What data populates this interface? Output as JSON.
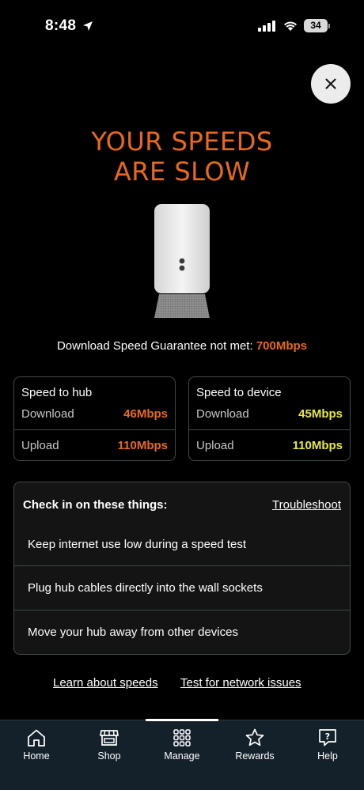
{
  "status_bar": {
    "time": "8:48",
    "battery": "34"
  },
  "headline": {
    "line1": "YOUR SPEEDS",
    "line2": "ARE SLOW"
  },
  "guarantee": {
    "text": "Download Speed Guarantee not met:",
    "value": "700Mbps"
  },
  "speed_cards": {
    "hub": {
      "title": "Speed to hub",
      "download_label": "Download",
      "download_value": "46Mbps",
      "upload_label": "Upload",
      "upload_value": "110Mbps"
    },
    "device": {
      "title": "Speed to device",
      "download_label": "Download",
      "download_value": "45Mbps",
      "upload_label": "Upload",
      "upload_value": "110Mbps"
    }
  },
  "check_panel": {
    "title": "Check in on these things:",
    "troubleshoot_label": "Troubleshoot",
    "items": [
      "Keep internet use low during a speed test",
      "Plug hub cables directly into the wall sockets",
      "Move your hub away from other devices"
    ]
  },
  "links": {
    "learn": "Learn about speeds",
    "test": "Test for network issues"
  },
  "nav": {
    "items": [
      {
        "label": "Home",
        "icon": "home-icon"
      },
      {
        "label": "Shop",
        "icon": "shop-icon"
      },
      {
        "label": "Manage",
        "icon": "grid-icon"
      },
      {
        "label": "Rewards",
        "icon": "star-icon"
      },
      {
        "label": "Help",
        "icon": "help-icon"
      }
    ],
    "active": "Manage"
  },
  "colors": {
    "accent_orange": "#e8691e",
    "accent_yellow": "#e6ea3b",
    "nav_bg": "#14202a",
    "border": "#3e4a47"
  }
}
